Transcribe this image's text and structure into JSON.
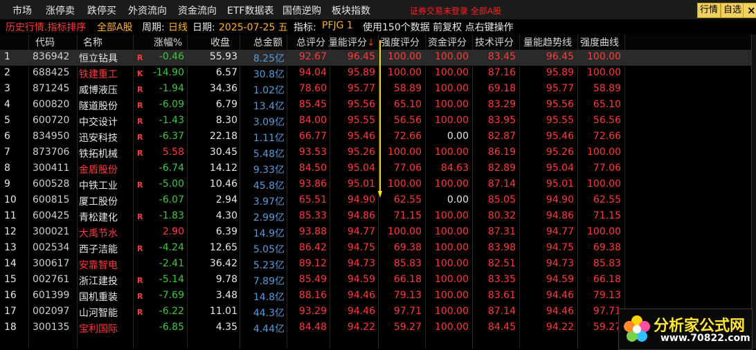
{
  "menu": [
    "市场",
    "涨停卖",
    "跌停买",
    "外资流向",
    "资金流向",
    "ETF数据表",
    "国债逆购",
    "板块指数"
  ],
  "notice": "证券交易未登录 全部A股",
  "toolbar": {
    "quote_label": "行情",
    "watch_label": "自选",
    "close_label": "×"
  },
  "info": {
    "title": "历史行情.指标排序",
    "market": "全部A股",
    "period_label": "周期:",
    "period": "日线",
    "date_label": "日期:",
    "date": "2025-07-25 五",
    "indicator_label": "指标:",
    "indicator": "PFJG 1",
    "note": "使用150个数据 前复权 点右键操作"
  },
  "columns": [
    "代码",
    "名称",
    "涨幅%",
    "收盘",
    "总金额",
    "总评分",
    "量能评分",
    "强度评分",
    "资金评分",
    "技术评分",
    "量能趋势线",
    "强度曲线"
  ],
  "sort_arrow": "↓",
  "colors": {
    "red": "#ff3b3b",
    "green": "#3ec83e",
    "white": "#e8e8e8",
    "blue": "#5a9ad8",
    "yellow": "#ffe400",
    "accent": "#ffb030"
  },
  "rows": [
    {
      "idx": "1",
      "code": "836942",
      "name": "恒立钻具",
      "tag": "R",
      "chg": "-0.46",
      "close": "55.93",
      "amt": "8.25亿",
      "total": "92.67",
      "vol": "96.45",
      "strength": "100.00",
      "fund": "100.00",
      "tech": "83.45",
      "voltrend": "96.45",
      "curve": "100.00",
      "nameColor": "#e8e8e8",
      "chgColor": "#3ec83e",
      "fundColor": "#ff3b3b"
    },
    {
      "idx": "2",
      "code": "688425",
      "name": "铁建重工",
      "tag": "K",
      "chg": "-14.90",
      "close": "6.57",
      "amt": "30.8亿",
      "total": "94.04",
      "vol": "95.89",
      "strength": "100.00",
      "fund": "100.00",
      "tech": "87.16",
      "voltrend": "95.89",
      "curve": "100.00",
      "nameColor": "#ff3b3b",
      "chgColor": "#3ec83e",
      "fundColor": "#ff3b3b"
    },
    {
      "idx": "3",
      "code": "871245",
      "name": "威博液压",
      "tag": "R",
      "chg": "-1.94",
      "close": "34.36",
      "amt": "1.02亿",
      "total": "78.60",
      "vol": "95.77",
      "strength": "58.89",
      "fund": "100.00",
      "tech": "69.18",
      "voltrend": "95.77",
      "curve": "58.89",
      "nameColor": "#e8e8e8",
      "chgColor": "#3ec83e",
      "fundColor": "#ff3b3b"
    },
    {
      "idx": "4",
      "code": "600820",
      "name": "隧道股份",
      "tag": "R",
      "chg": "-6.09",
      "close": "6.79",
      "amt": "13.4亿",
      "total": "85.45",
      "vol": "95.56",
      "strength": "65.10",
      "fund": "100.00",
      "tech": "83.29",
      "voltrend": "95.56",
      "curve": "65.10",
      "nameColor": "#e8e8e8",
      "chgColor": "#3ec83e",
      "fundColor": "#ff3b3b"
    },
    {
      "idx": "5",
      "code": "600720",
      "name": "中交设计",
      "tag": "R",
      "chg": "-1.43",
      "close": "8.30",
      "amt": "3.09亿",
      "total": "84.00",
      "vol": "95.55",
      "strength": "56.56",
      "fund": "100.00",
      "tech": "83.95",
      "voltrend": "95.55",
      "curve": "56.56",
      "nameColor": "#e8e8e8",
      "chgColor": "#3ec83e",
      "fundColor": "#ff3b3b"
    },
    {
      "idx": "6",
      "code": "834950",
      "name": "迅安科技",
      "tag": "R",
      "chg": "-6.37",
      "close": "22.18",
      "amt": "1.11亿",
      "total": "66.77",
      "vol": "95.46",
      "strength": "72.66",
      "fund": "0.00",
      "tech": "82.87",
      "voltrend": "95.46",
      "curve": "72.66",
      "nameColor": "#e8e8e8",
      "chgColor": "#3ec83e",
      "fundColor": "#e8e8e8"
    },
    {
      "idx": "7",
      "code": "873706",
      "name": "铁拓机械",
      "tag": "R",
      "chg": "5.58",
      "close": "30.45",
      "amt": "5.48亿",
      "total": "93.53",
      "vol": "95.26",
      "strength": "100.00",
      "fund": "100.00",
      "tech": "86.19",
      "voltrend": "95.26",
      "curve": "100.00",
      "nameColor": "#e8e8e8",
      "chgColor": "#ff3b3b",
      "fundColor": "#ff3b3b"
    },
    {
      "idx": "8",
      "code": "300411",
      "name": "金盾股份",
      "tag": "",
      "chg": "-6.74",
      "close": "14.12",
      "amt": "9.33亿",
      "total": "84.50",
      "vol": "95.04",
      "strength": "77.06",
      "fund": "84.63",
      "tech": "82.89",
      "voltrend": "95.04",
      "curve": "77.06",
      "nameColor": "#ff3b3b",
      "chgColor": "#3ec83e",
      "fundColor": "#ff3b3b"
    },
    {
      "idx": "9",
      "code": "600528",
      "name": "中铁工业",
      "tag": "R",
      "chg": "-5.00",
      "close": "10.46",
      "amt": "45.8亿",
      "total": "93.86",
      "vol": "95.01",
      "strength": "100.00",
      "fund": "100.00",
      "tech": "87.14",
      "voltrend": "95.01",
      "curve": "100.00",
      "nameColor": "#e8e8e8",
      "chgColor": "#3ec83e",
      "fundColor": "#ff3b3b"
    },
    {
      "idx": "10",
      "code": "600815",
      "name": "厦工股份",
      "tag": "",
      "chg": "-6.07",
      "close": "2.94",
      "amt": "3.97亿",
      "total": "65.51",
      "vol": "94.90",
      "strength": "62.55",
      "fund": "0.00",
      "tech": "85.05",
      "voltrend": "94.90",
      "curve": "62.55",
      "nameColor": "#e8e8e8",
      "chgColor": "#3ec83e",
      "fundColor": "#e8e8e8"
    },
    {
      "idx": "11",
      "code": "600425",
      "name": "青松建化",
      "tag": "R",
      "chg": "-1.83",
      "close": "4.30",
      "amt": "2.99亿",
      "total": "85.33",
      "vol": "94.86",
      "strength": "71.15",
      "fund": "100.00",
      "tech": "80.32",
      "voltrend": "94.86",
      "curve": "71.15",
      "nameColor": "#e8e8e8",
      "chgColor": "#3ec83e",
      "fundColor": "#ff3b3b"
    },
    {
      "idx": "12",
      "code": "300021",
      "name": "大禹节水",
      "tag": "",
      "chg": "2.90",
      "close": "6.39",
      "amt": "14.9亿",
      "total": "93.88",
      "vol": "94.77",
      "strength": "100.00",
      "fund": "100.00",
      "tech": "87.31",
      "voltrend": "94.77",
      "curve": "100.00",
      "nameColor": "#ff3b3b",
      "chgColor": "#ff3b3b",
      "fundColor": "#ff3b3b"
    },
    {
      "idx": "13",
      "code": "002534",
      "name": "西子洁能",
      "tag": "R",
      "chg": "-4.24",
      "close": "12.65",
      "amt": "5.05亿",
      "total": "86.42",
      "vol": "94.75",
      "strength": "69.38",
      "fund": "100.00",
      "tech": "83.98",
      "voltrend": "94.75",
      "curve": "69.38",
      "nameColor": "#e8e8e8",
      "chgColor": "#3ec83e",
      "fundColor": "#ff3b3b"
    },
    {
      "idx": "14",
      "code": "300617",
      "name": "安靠智电",
      "tag": "",
      "chg": "-2.41",
      "close": "36.42",
      "amt": "5.23亿",
      "total": "89.12",
      "vol": "94.73",
      "strength": "85.83",
      "fund": "100.00",
      "tech": "82.51",
      "voltrend": "94.73",
      "curve": "85.83",
      "nameColor": "#ff3b3b",
      "chgColor": "#3ec83e",
      "fundColor": "#ff3b3b"
    },
    {
      "idx": "15",
      "code": "002761",
      "name": "浙江建投",
      "tag": "R",
      "chg": "-5.14",
      "close": "9.78",
      "amt": "7.89亿",
      "total": "85.49",
      "vol": "94.59",
      "strength": "66.18",
      "fund": "100.00",
      "tech": "83.35",
      "voltrend": "94.59",
      "curve": "66.18",
      "nameColor": "#e8e8e8",
      "chgColor": "#3ec83e",
      "fundColor": "#ff3b3b"
    },
    {
      "idx": "16",
      "code": "601399",
      "name": "国机重装",
      "tag": "R",
      "chg": "-7.69",
      "close": "3.48",
      "amt": "14.8亿",
      "total": "88.16",
      "vol": "94.46",
      "strength": "79.13",
      "fund": "100.00",
      "tech": "83.61",
      "voltrend": "94.46",
      "curve": "79.13",
      "nameColor": "#e8e8e8",
      "chgColor": "#3ec83e",
      "fundColor": "#ff3b3b"
    },
    {
      "idx": "17",
      "code": "002097",
      "name": "山河智能",
      "tag": "R",
      "chg": "-6.22",
      "close": "11.01",
      "amt": "44.3亿",
      "total": "93.29",
      "vol": "94.46",
      "strength": "97.71",
      "fund": "100.00",
      "tech": "87.14",
      "voltrend": "94.46",
      "curve": "97.71",
      "nameColor": "#e8e8e8",
      "chgColor": "#3ec83e",
      "fundColor": "#ff3b3b"
    },
    {
      "idx": "18",
      "code": "300135",
      "name": "宝利国际",
      "tag": "",
      "chg": "-6.85",
      "close": "4.35",
      "amt": "4.44亿",
      "total": "84.48",
      "vol": "94.22",
      "strength": "59.27",
      "fund": "100.00",
      "tech": "84.45",
      "voltrend": "94.22",
      "curve": "59.27",
      "nameColor": "#ff3b3b",
      "chgColor": "#3ec83e",
      "fundColor": "#ff3b3b"
    }
  ],
  "logo": {
    "main": "分析家公式网",
    "url": "www.70822.com"
  }
}
